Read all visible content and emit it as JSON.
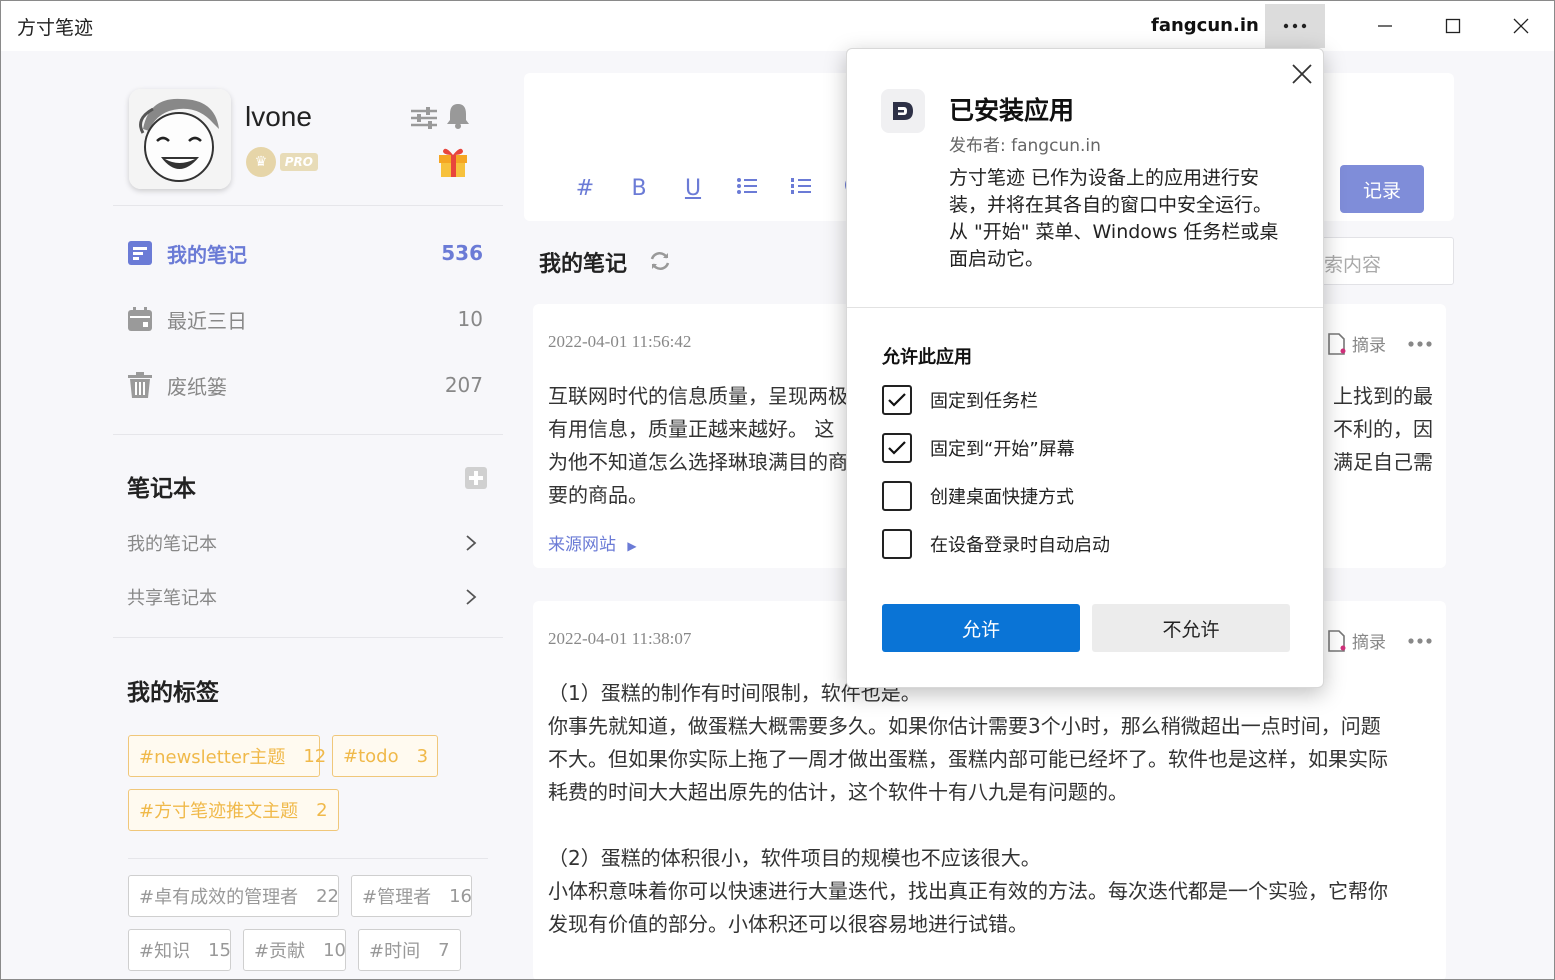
{
  "titlebar": {
    "app_title": "方寸笔迹",
    "host": "fangcun.in",
    "more_label": "···"
  },
  "profile": {
    "username": "lvone",
    "badge": "PRO"
  },
  "nav": [
    {
      "label": "我的笔记",
      "count": "536",
      "icon": "note-icon",
      "active": true
    },
    {
      "label": "最近三日",
      "count": "10",
      "icon": "calendar-icon",
      "active": false
    },
    {
      "label": "废纸篓",
      "count": "207",
      "icon": "trash-icon",
      "active": false
    }
  ],
  "notebooks": {
    "title": "笔记本",
    "items": [
      "我的笔记本",
      "共享笔记本"
    ]
  },
  "tags": {
    "title": "我的标签",
    "highlighted": [
      {
        "name": "#newsletter主题",
        "count": "12"
      },
      {
        "name": "#todo",
        "count": "3"
      },
      {
        "name": "#方寸笔迹推文主题",
        "count": "2"
      }
    ],
    "others": [
      {
        "name": "#卓有成效的管理者",
        "count": "22"
      },
      {
        "name": "#管理者",
        "count": "16"
      },
      {
        "name": "#知识",
        "count": "15"
      },
      {
        "name": "#贡献",
        "count": "10"
      },
      {
        "name": "#时间",
        "count": "7"
      }
    ]
  },
  "editor": {
    "tools": [
      "#",
      "B",
      "U",
      "bullet-list-icon",
      "number-list-icon",
      "emoji-icon"
    ],
    "record_label": "记录"
  },
  "list": {
    "title": "我的笔记",
    "search_placeholder": "索内容"
  },
  "notes": [
    {
      "date": "2022-04-01 11:56:42",
      "excerpt_label": "摘录",
      "body_left": "互联网时代的信息质量，呈现两极\n有用信息，质量正越来越好。 这\n为他不知道怎么选择琳琅满目的商\n要的商品。",
      "body_right": "上找到的最\n不利的，因\n满足自己需\n",
      "link": "来源网站"
    },
    {
      "date": "2022-04-01 11:38:07",
      "excerpt_label": "摘录",
      "body": "（1）蛋糕的制作有时间限制，软件也是。\n你事先就知道，做蛋糕大概需要多久。如果你估计需要3个小时，那么稍微超出一点时间，问题\n不大。但如果你实际上拖了一周才做出蛋糕，蛋糕内部可能已经坏了。软件也是这样，如果实际\n耗费的时间大大超出原先的估计，这个软件十有八九是有问题的。\n\n（2）蛋糕的体积很小，软件项目的规模也不应该很大。\n小体积意味着你可以快速进行大量迭代，找出真正有效的方法。每次迭代都是一个实验，它帮你\n发现有价值的部分。小体积还可以很容易地进行试错。"
    }
  ],
  "popup": {
    "title": "已安装应用",
    "publisher": "发布者: fangcun.in",
    "description": "方寸笔迹 已作为设备上的应用进行安装，并将在其各自的窗口中安全运行。从 \"开始\" 菜单、Windows 任务栏或桌面启动它。",
    "section": "允许此应用",
    "options": [
      {
        "label": "固定到任务栏",
        "checked": true
      },
      {
        "label": "固定到“开始”屏幕",
        "checked": true
      },
      {
        "label": "创建桌面快捷方式",
        "checked": false
      },
      {
        "label": "在设备登录时自动启动",
        "checked": false
      }
    ],
    "allow_label": "允许",
    "deny_label": "不允许"
  },
  "colors": {
    "accent": "#6b7bd6",
    "allow_button": "#0a74d6",
    "tag_highlight": "#f0b94a"
  }
}
